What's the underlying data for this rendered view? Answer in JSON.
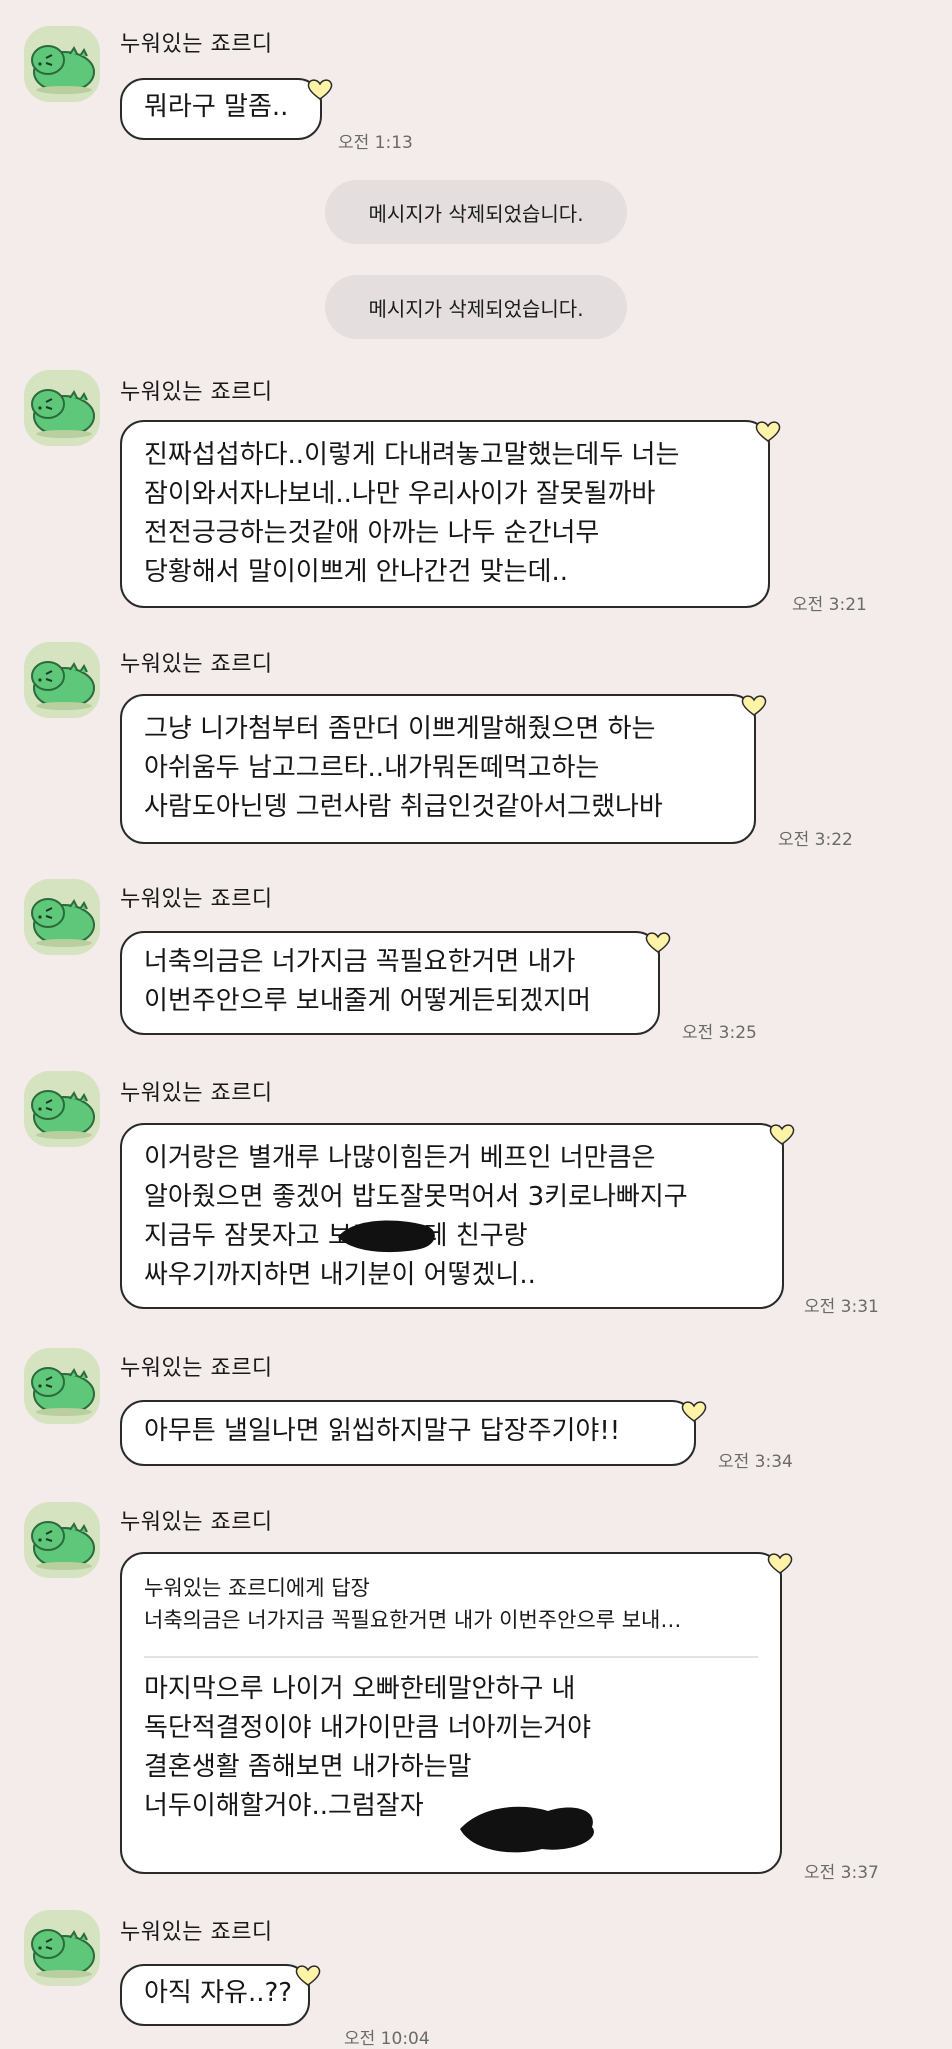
{
  "chat": {
    "sender_name": "누워있는 죠르디",
    "first_message": {
      "text": "뭐라구 말좀..",
      "time": "오전 1:13"
    },
    "deleted_notices": [
      "메시지가 삭제되었습니다.",
      "메시지가 삭제되었습니다."
    ],
    "messages": [
      {
        "lines": [
          "진짜섭섭하다..이렇게 다내려놓고말했는데두 너는",
          "잠이와서자나보네..나만 우리사이가 잘못될까바",
          "전전긍긍하는것같애 아까는 나두 순간너무",
          "당황해서 말이이쁘게 안나간건 맞는데.."
        ],
        "time": "오전 3:21"
      },
      {
        "lines": [
          "그냥 니가첨부터 좀만더 이쁘게말해줬으면 하는",
          "아쉬움두 남고그르타..내가뭐돈떼먹고하는",
          "사람도아닌뎅 그런사람 취급인것같아서그랬나바"
        ],
        "time": "오전 3:22"
      },
      {
        "lines": [
          "너축의금은 너가지금 꼭필요한거면 내가",
          "이번주안으루 보내줄게 어떻게든되겠지머"
        ],
        "time": "오전 3:25"
      },
      {
        "lines": [
          "이거랑은 별개루 나많이힘든거 베프인 너만큼은",
          "알아줬으면 좋겠어 밥도잘못먹어서 3키로나빠지구",
          "지금두 잠못자고 보고있는데 친구랑",
          "싸우기까지하면 내기분이 어떻겠니.."
        ],
        "time": "오전 3:31"
      },
      {
        "lines": [
          "아무튼 낼일나면 읽씹하지말구 답장주기야!!"
        ],
        "time": "오전 3:34"
      },
      {
        "reply_header": "누워있는 죠르디에게 답장",
        "reply_quote": "너축의금은 너가지금 꼭필요한거면 내가 이번주안으루 보내…",
        "lines": [
          "마지막으루 나이거 오빠한테말안하구 내",
          "독단적결정이야 내가이만큼 너아끼는거야",
          "결혼생활 좀해보면 내가하는말",
          "너두이해할거야..그럼잘자"
        ],
        "time": "오전 3:37"
      },
      {
        "lines": [
          "아직 자유..??"
        ],
        "time": "오전 10:04"
      }
    ]
  },
  "icons": {
    "avatar": "jordy-dinosaur-avatar",
    "bubble_tag": "heart-icon"
  },
  "colors": {
    "background": "#f3ecea",
    "bubble": "#ffffff",
    "bubble_border": "#2a2a2a",
    "deleted_bubble": "#e4dfde",
    "avatar_bg": "#d6e3c0",
    "avatar_character": "#5fc77a",
    "heart": "#fff3a8"
  }
}
